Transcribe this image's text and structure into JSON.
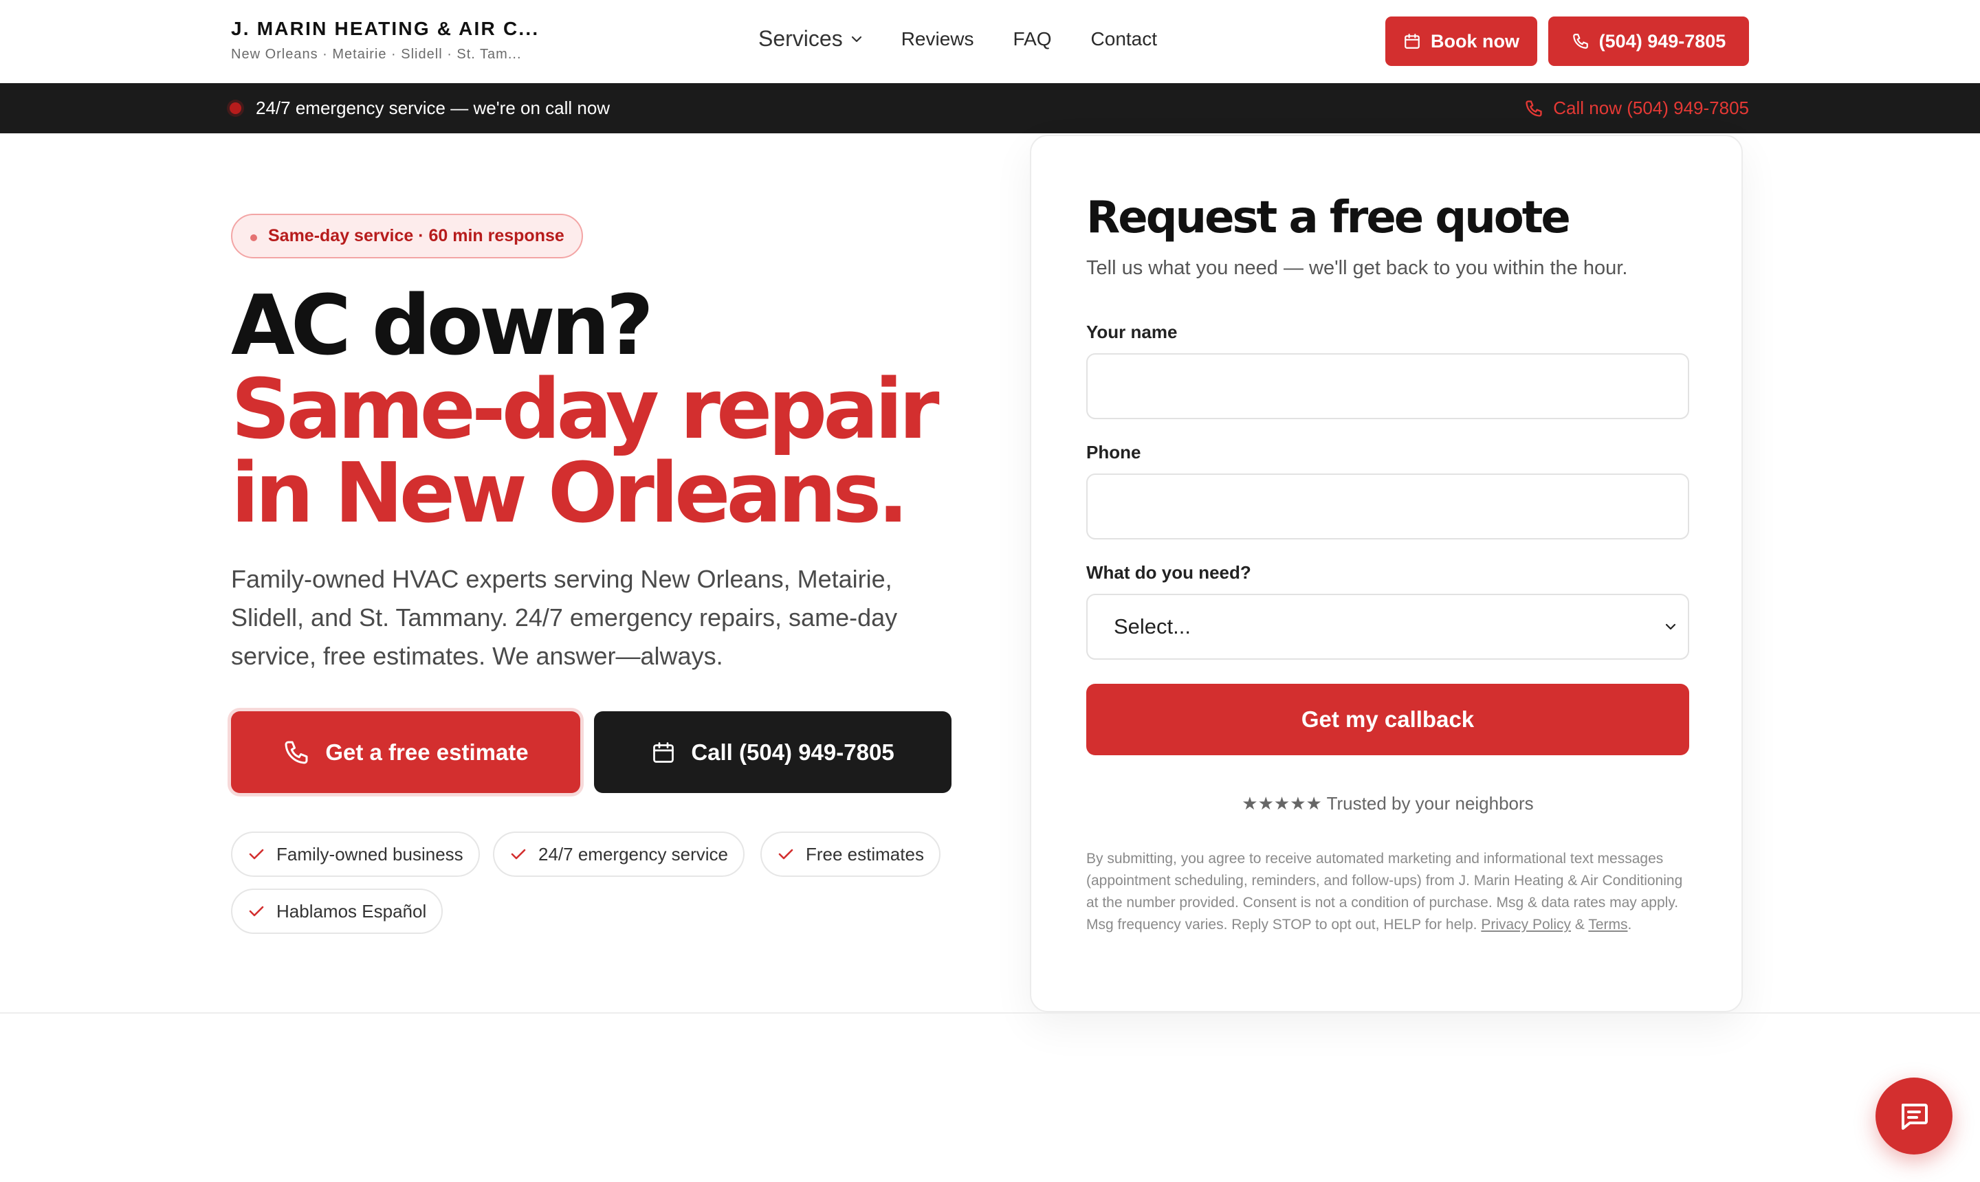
{
  "header": {
    "brand_name": "J. MARIN HEATING & AIR C...",
    "brand_sub": "New Orleans · Metairie · Slidell · St. Tam...",
    "nav": {
      "services": "Services",
      "reviews": "Reviews",
      "faq": "FAQ",
      "contact": "Contact"
    },
    "book_label": "Book now",
    "phone_label": "(504) 949-7805"
  },
  "emergency_bar": {
    "text": "24/7 emergency service — we're on call now",
    "call_label": "Call now (504) 949-7805"
  },
  "hero": {
    "badge": "Same-day service · 60 min response",
    "headline_1": "AC down?",
    "headline_2": "Same-day repair",
    "headline_3": "in New Orleans.",
    "description": "Family-owned HVAC experts serving New Orleans, Metairie, Slidell, and St. Tammany. 24/7 emergency repairs, same-day service, free estimates. We answer—always.",
    "cta_estimate": "Get a free estimate",
    "cta_call": "Call (504) 949-7805",
    "chips": [
      "Family-owned business",
      "24/7 emergency service",
      "Free estimates",
      "Hablamos Español"
    ]
  },
  "quote_form": {
    "title": "Request a free quote",
    "subtitle": "Tell us what you need — we'll get back to you within the hour.",
    "name_label": "Your name",
    "phone_label": "Phone",
    "need_label": "What do you need?",
    "need_value": "Select...",
    "submit_label": "Get my callback",
    "trust_text": "★★★★★ Trusted by your neighbors",
    "legal_text": "By submitting, you agree to receive automated marketing and informational text messages (appointment scheduling, reminders, and follow-ups) from J. Marin Heating & Air Conditioning at the number provided. Consent is not a condition of purchase. Msg & data rates may apply. Msg frequency varies. Reply STOP to opt out, HELP for help.",
    "privacy_label": "Privacy Policy",
    "amp": "&",
    "terms_label": "Terms",
    "period": "."
  },
  "icons": {
    "chevron": "chevron-down-icon",
    "calendar": "calendar-icon",
    "phone": "phone-icon",
    "check": "check-icon",
    "chat": "chat-icon"
  },
  "colors": {
    "accent": "#d32f2f",
    "dark": "#1b1b1b",
    "badge_bg": "#fdecec"
  }
}
